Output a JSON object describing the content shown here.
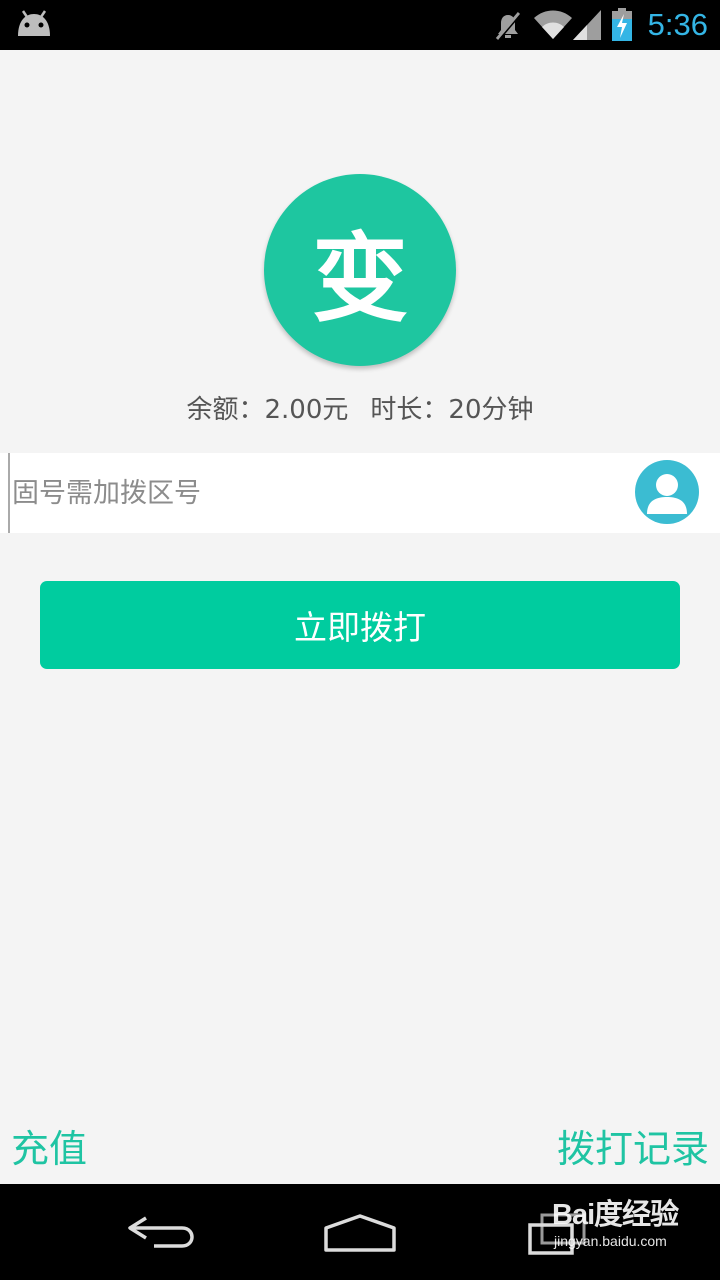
{
  "status_bar": {
    "time": "5:36",
    "icons": [
      "android-icon",
      "mute-icon",
      "wifi-icon",
      "signal-icon",
      "battery-charging-icon"
    ],
    "time_color": "#34b5e5"
  },
  "logo": {
    "char": "变",
    "color": "#1ec6a0"
  },
  "balance": {
    "balance_label": "余额：",
    "balance_value": "2.00元",
    "duration_label": "时长：",
    "duration_value": "20分钟"
  },
  "phone_input": {
    "placeholder": "固号需加拨区号",
    "value": ""
  },
  "contact_button": {
    "icon": "contact-person-icon",
    "color": "#3bbcd2"
  },
  "dial_button": {
    "label": "立即拨打",
    "color": "#00cc9f"
  },
  "bottom_links": {
    "recharge": "充值",
    "history": "拨打记录",
    "color": "#1fc4a3"
  },
  "nav_bar": {
    "icons": [
      "back-icon",
      "home-icon",
      "recent-apps-icon"
    ]
  },
  "watermark": {
    "name": "Bai度经验",
    "url": "jingyan.baidu.com"
  }
}
